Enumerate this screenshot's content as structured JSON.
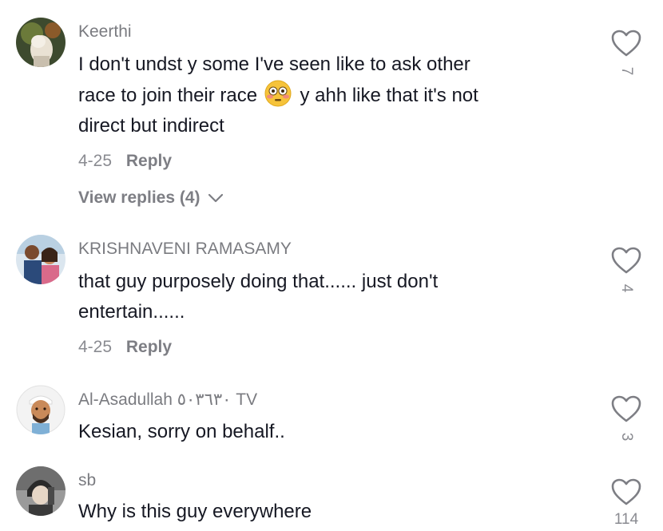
{
  "comments": [
    {
      "username": "Keerthi",
      "text_1": "I don't undst y some I've seen like to ask other",
      "text_2a": "race to join their race",
      "text_2b": "y ahh like that it's not",
      "text_3": "direct but indirect",
      "date": "4-25",
      "reply_label": "Reply",
      "view_replies": "View replies (4)",
      "likes": "7",
      "emoji": "flushed-face-emoji"
    },
    {
      "username": "KRISHNAVENI RAMASAMY",
      "text_1": "that guy purposely doing that...... just don't",
      "text_2": "entertain......",
      "date": "4-25",
      "reply_label": "Reply",
      "likes": "4"
    },
    {
      "username": "Al-Asadullah ٥٠٣٦٣٠ TV",
      "text_1": "Kesian, sorry on behalf..",
      "likes": "3"
    },
    {
      "username": "sb",
      "text_1": "Why is this guy everywhere",
      "likes": "114"
    }
  ],
  "icons": {
    "like": "heart-outline-icon",
    "expand": "chevron-down-icon"
  },
  "colors": {
    "text": "#161823",
    "muted": "#8a8b91",
    "icon": "#7d7e84"
  }
}
